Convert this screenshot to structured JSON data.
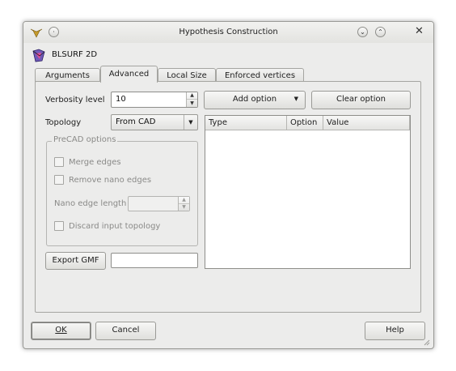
{
  "window": {
    "title": "Hypothesis Construction",
    "hypothesis_name": "BLSURF 2D",
    "icons": {
      "app": "app-menu-icon",
      "minimize": "minimize-icon",
      "maximize": "maximize-icon",
      "close": "close-icon",
      "pin": "pin-icon"
    }
  },
  "tabs": [
    {
      "label": "Arguments",
      "active": false
    },
    {
      "label": "Advanced",
      "active": true
    },
    {
      "label": "Local Size",
      "active": false
    },
    {
      "label": "Enforced vertices",
      "active": false
    }
  ],
  "advanced": {
    "verbosity_label": "Verbosity level",
    "verbosity_value": "10",
    "topology_label": "Topology",
    "topology_value": "From CAD",
    "add_option_label": "Add option",
    "clear_option_label": "Clear option",
    "precad": {
      "title": "PreCAD options",
      "merge_edges": "Merge edges",
      "remove_nano_edges": "Remove nano edges",
      "nano_edge_length_label": "Nano edge length",
      "nano_edge_length_value": "",
      "discard_input_topology": "Discard input topology"
    },
    "export_gmf_label": "Export GMF",
    "export_gmf_value": "",
    "options_table": {
      "columns": [
        "Type",
        "Option",
        "Value"
      ],
      "rows": []
    }
  },
  "buttons": {
    "ok": "OK",
    "cancel": "Cancel",
    "help": "Help"
  }
}
